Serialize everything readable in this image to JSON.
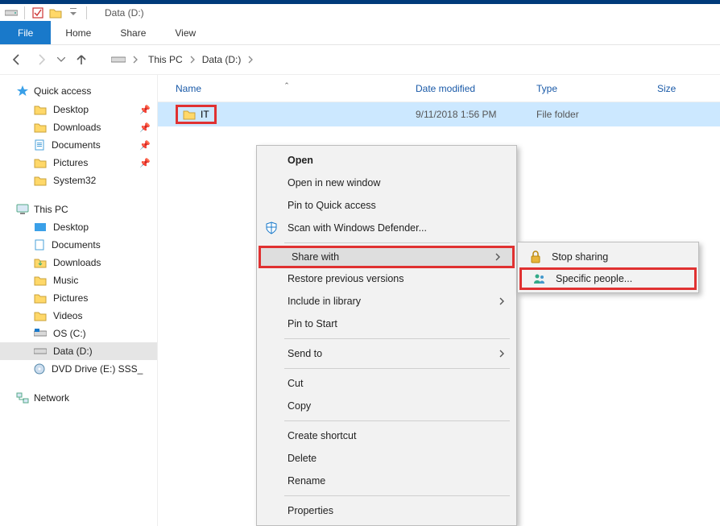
{
  "window": {
    "title": "Data (D:)"
  },
  "ribbon": {
    "tabs": {
      "file": "File",
      "home": "Home",
      "share": "Share",
      "view": "View"
    }
  },
  "breadcrumb": {
    "root": "This PC",
    "drive": "Data (D:)"
  },
  "sidebar": {
    "quick_access": {
      "label": "Quick access",
      "items": [
        {
          "label": "Desktop",
          "pinned": true
        },
        {
          "label": "Downloads",
          "pinned": true
        },
        {
          "label": "Documents",
          "pinned": true
        },
        {
          "label": "Pictures",
          "pinned": true
        },
        {
          "label": "System32",
          "pinned": false
        }
      ]
    },
    "this_pc": {
      "label": "This PC",
      "items": [
        {
          "label": "Desktop"
        },
        {
          "label": "Documents"
        },
        {
          "label": "Downloads"
        },
        {
          "label": "Music"
        },
        {
          "label": "Pictures"
        },
        {
          "label": "Videos"
        },
        {
          "label": "OS (C:)"
        },
        {
          "label": "Data (D:)",
          "selected": true
        },
        {
          "label": "DVD Drive (E:) SSS_"
        }
      ]
    },
    "network": {
      "label": "Network"
    }
  },
  "columns": {
    "name": "Name",
    "date": "Date modified",
    "type": "Type",
    "size": "Size"
  },
  "rows": [
    {
      "name": "IT",
      "date": "9/11/2018 1:56 PM",
      "type": "File folder"
    }
  ],
  "context_menu": {
    "open": "Open",
    "open_new": "Open in new window",
    "pin_quick": "Pin to Quick access",
    "scan_defender": "Scan with Windows Defender...",
    "share_with": "Share with",
    "restore_prev": "Restore previous versions",
    "include_library": "Include in library",
    "pin_start": "Pin to Start",
    "send_to": "Send to",
    "cut": "Cut",
    "copy": "Copy",
    "create_shortcut": "Create shortcut",
    "delete": "Delete",
    "rename": "Rename",
    "properties": "Properties"
  },
  "submenu": {
    "stop_sharing": "Stop sharing",
    "specific_people": "Specific people..."
  }
}
